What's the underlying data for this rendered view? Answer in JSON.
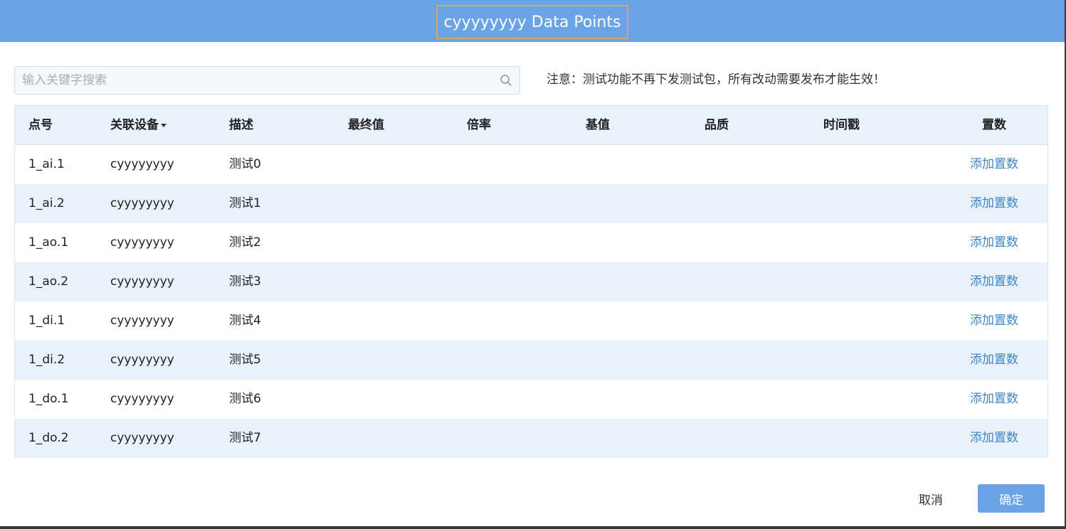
{
  "dialog": {
    "title": "cyyyyyyyy Data Points"
  },
  "search": {
    "placeholder": "输入关键字搜索",
    "value": "",
    "icon": "search-icon"
  },
  "notice": "注意：测试功能不再下发测试包，所有改动需要发布才能生效！",
  "table": {
    "columns": [
      "点号",
      "关联设备",
      "描述",
      "最终值",
      "倍率",
      "基值",
      "品质",
      "时间戳",
      "置数"
    ],
    "sortable_column_icon": "caret-down-icon",
    "rows": [
      {
        "point": "1_ai.1",
        "device": "cyyyyyyyy",
        "desc": "测试0",
        "final": "",
        "rate": "",
        "base": "",
        "quality": "",
        "timestamp": "",
        "action": "添加置数"
      },
      {
        "point": "1_ai.2",
        "device": "cyyyyyyyy",
        "desc": "测试1",
        "final": "",
        "rate": "",
        "base": "",
        "quality": "",
        "timestamp": "",
        "action": "添加置数"
      },
      {
        "point": "1_ao.1",
        "device": "cyyyyyyyy",
        "desc": "测试2",
        "final": "",
        "rate": "",
        "base": "",
        "quality": "",
        "timestamp": "",
        "action": "添加置数"
      },
      {
        "point": "1_ao.2",
        "device": "cyyyyyyyy",
        "desc": "测试3",
        "final": "",
        "rate": "",
        "base": "",
        "quality": "",
        "timestamp": "",
        "action": "添加置数"
      },
      {
        "point": "1_di.1",
        "device": "cyyyyyyyy",
        "desc": "测试4",
        "final": "",
        "rate": "",
        "base": "",
        "quality": "",
        "timestamp": "",
        "action": "添加置数"
      },
      {
        "point": "1_di.2",
        "device": "cyyyyyyyy",
        "desc": "测试5",
        "final": "",
        "rate": "",
        "base": "",
        "quality": "",
        "timestamp": "",
        "action": "添加置数"
      },
      {
        "point": "1_do.1",
        "device": "cyyyyyyyy",
        "desc": "测试6",
        "final": "",
        "rate": "",
        "base": "",
        "quality": "",
        "timestamp": "",
        "action": "添加置数"
      },
      {
        "point": "1_do.2",
        "device": "cyyyyyyyy",
        "desc": "测试7",
        "final": "",
        "rate": "",
        "base": "",
        "quality": "",
        "timestamp": "",
        "action": "添加置数"
      }
    ]
  },
  "footer": {
    "cancel_label": "取消",
    "ok_label": "确定"
  },
  "colors": {
    "header_bg": "#6aa3e6",
    "title_border": "#d9a36a",
    "row_alt_bg": "#e9f1fb",
    "link": "#3f86c7",
    "primary_button": "#6aa3e6"
  }
}
